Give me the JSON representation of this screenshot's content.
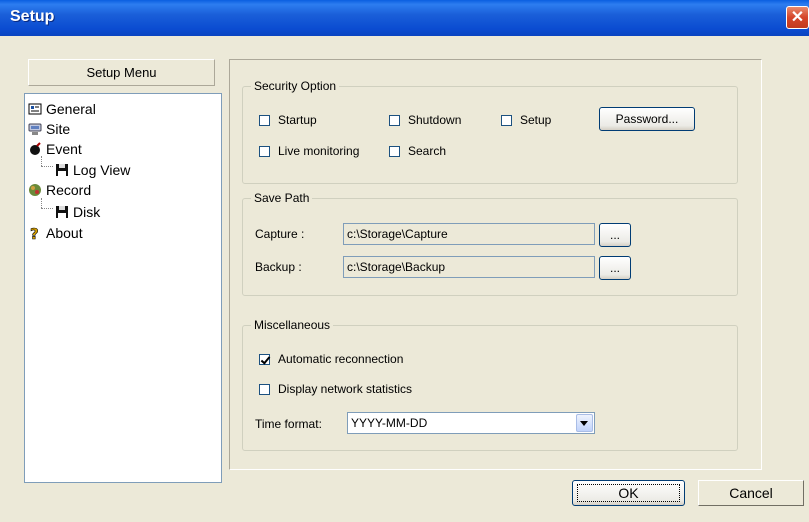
{
  "window": {
    "title": "Setup"
  },
  "menu": {
    "header": "Setup Menu",
    "items": [
      {
        "label": "General",
        "icon": "general-icon"
      },
      {
        "label": "Site",
        "icon": "site-icon"
      },
      {
        "label": "Event",
        "icon": "event-icon"
      },
      {
        "label": "Log View",
        "icon": "floppy-icon"
      },
      {
        "label": "Record",
        "icon": "record-icon"
      },
      {
        "label": "Disk",
        "icon": "floppy-icon"
      },
      {
        "label": "About",
        "icon": "question-icon"
      }
    ]
  },
  "security": {
    "title": "Security Option",
    "startup": "Startup",
    "shutdown": "Shutdown",
    "setup": "Setup",
    "live": "Live monitoring",
    "search": "Search",
    "password_button": "Password..."
  },
  "save_path": {
    "title": "Save Path",
    "capture_label": "Capture :",
    "capture_value": "c:\\Storage\\Capture",
    "backup_label": "Backup :",
    "backup_value": "c:\\Storage\\Backup",
    "browse_label": "..."
  },
  "misc": {
    "title": "Miscellaneous",
    "auto_reconnect": "Automatic reconnection",
    "auto_reconnect_checked": true,
    "display_stats": "Display network statistics",
    "display_stats_checked": false,
    "time_format_label": "Time format:",
    "time_format_value": "YYYY-MM-DD"
  },
  "footer": {
    "ok": "OK",
    "cancel": "Cancel"
  }
}
